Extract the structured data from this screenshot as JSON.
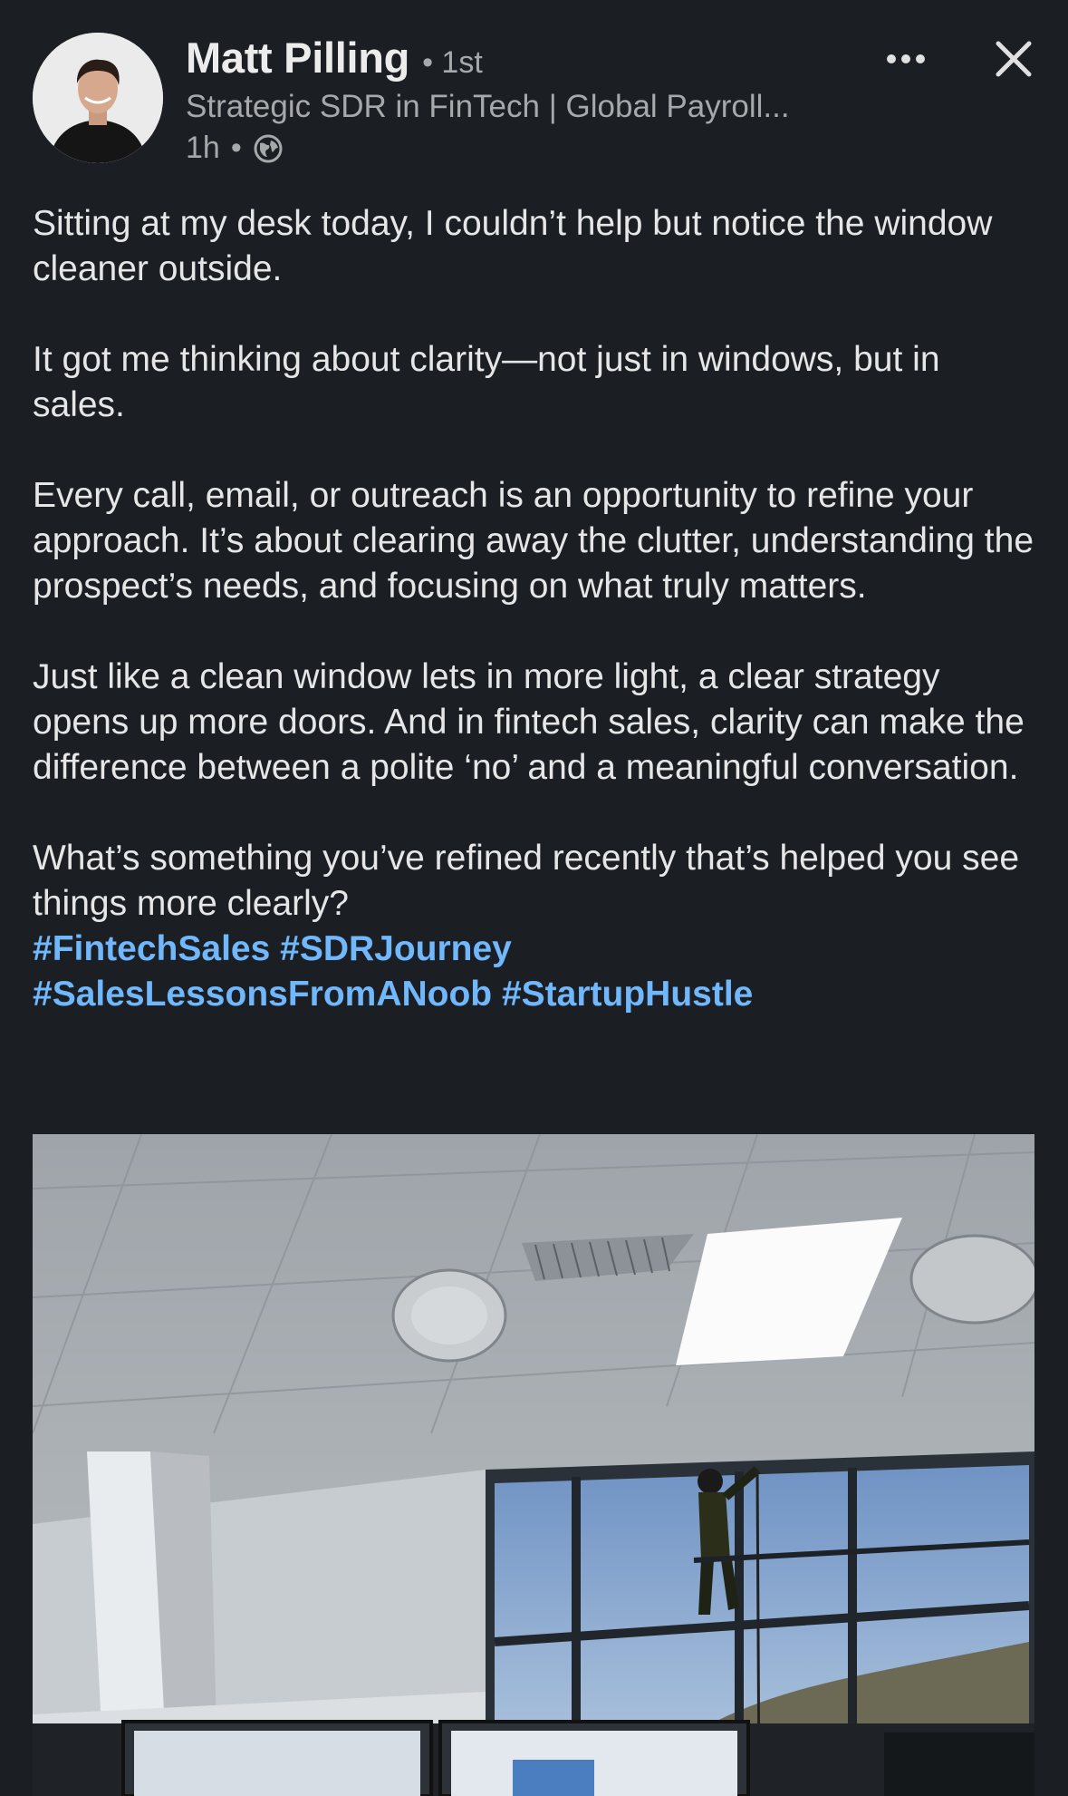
{
  "author": {
    "name": "Matt Pilling",
    "connection_degree": "• 1st",
    "headline": "Strategic SDR in FinTech | Global Payroll...",
    "time_ago": "1h",
    "meta_separator": "•",
    "visibility_icon": "globe-icon"
  },
  "actions": {
    "more_icon": "more-horizontal-icon",
    "close_icon": "close-icon"
  },
  "post": {
    "paragraphs": [
      "Sitting at my desk today, I couldn’t help but notice the window cleaner outside.",
      "It got me thinking about clarity—not just in windows, but in sales.",
      "Every call, email, or outreach is an opportunity to refine your approach. It’s about clearing away the clutter, understanding the prospect’s needs, and focusing on what truly matters.",
      "Just like a clean window lets in more light, a clear strategy opens up more doors. And in fintech sales, clarity can make the difference between a polite ‘no’ and a meaningful conversation.",
      "What’s something you’ve refined recently that’s helped you see things more clearly?"
    ],
    "hashtags": [
      "#FintechSales",
      "#SDRJourney",
      "#SalesLessonsFromANoob",
      "#StartupHustle"
    ]
  },
  "colors": {
    "background": "#1b1f23",
    "text": "#e6e6e6",
    "secondary_text": "#a6a8aa",
    "hashtag": "#71b7fb"
  }
}
